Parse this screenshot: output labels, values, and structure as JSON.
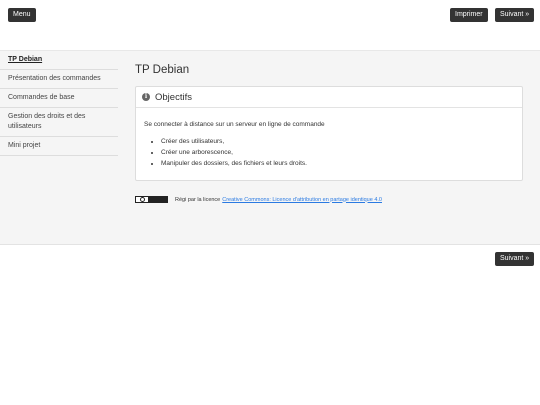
{
  "header": {
    "menu_label": "Menu",
    "print_label": "Imprimer",
    "next_label": "Suivant »"
  },
  "sidebar": {
    "items": [
      {
        "label": "TP Debian"
      },
      {
        "label": "Présentation des commandes"
      },
      {
        "label": "Commandes de base"
      },
      {
        "label": "Gestion des droits et des utilisateurs"
      },
      {
        "label": "Mini projet"
      }
    ]
  },
  "main": {
    "title": "TP Debian",
    "panel": {
      "icon": "info-icon",
      "title": "Objectifs",
      "intro": "Se connecter à distance sur un serveur en ligne de commande",
      "bullets": [
        "Créer des utilisateurs,",
        "Créer une arborescence,",
        "Manipuler des dossiers, des fichiers et leurs droits."
      ]
    },
    "license": {
      "badge_icon": "cc-by-sa-badge",
      "text": "Régi par la licence",
      "link_text": "Creative Commons: Licence d'attribution en partage identique 4.0"
    }
  },
  "footer": {
    "next_label": "Suivant »"
  }
}
